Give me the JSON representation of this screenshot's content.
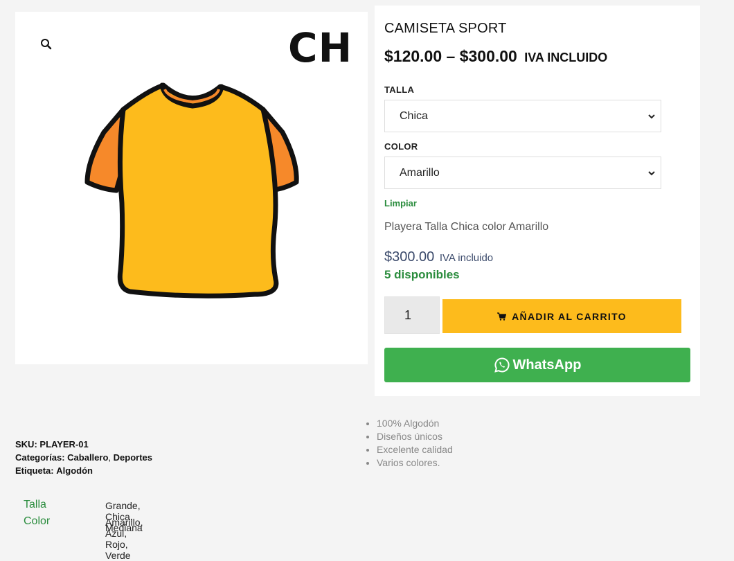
{
  "gallery": {
    "size_mark": "CH",
    "zoom_icon": "magnifier-icon",
    "shirt_colors": {
      "body": "#fdbb1c",
      "trim": "#f6892a",
      "outline": "#111111"
    }
  },
  "product": {
    "title": "CAMISETA SPORT",
    "price_range": "$120.00 – $300.00",
    "price_suffix": "IVA INCLUIDO",
    "talla_label": "TALLA",
    "talla_value": "Chica",
    "color_label": "COLOR",
    "color_value": "Amarillo",
    "clear_label": "Limpiar",
    "variation_description": "Playera Talla Chica color Amarillo",
    "variation_price": "$300.00",
    "variation_price_suffix": "IVA incluido",
    "stock": "5 disponibles",
    "quantity": "1",
    "add_to_cart": "AÑADIR AL CARRITO",
    "whatsapp": "WhatsApp"
  },
  "features": [
    "100% Algodón",
    "Diseños únicos",
    "Excelente calidad",
    "Varios colores."
  ],
  "meta": {
    "sku_label": "SKU:",
    "sku_value": "PLAYER-01",
    "categories_label": "Categorías:",
    "categories": [
      "Caballero",
      "Deportes"
    ],
    "tag_label": "Etiqueta:",
    "tag": "Algodón"
  },
  "attributes": [
    {
      "name": "Talla",
      "values": "Grande, Chica, Mediana"
    },
    {
      "name": "Color",
      "values": "Amarillo, Azul, Rojo, Verde"
    }
  ],
  "colors": {
    "accent_yellow": "#fdbb1c",
    "whatsapp_green": "#3fb04f",
    "text_green": "#2a8c3d"
  }
}
